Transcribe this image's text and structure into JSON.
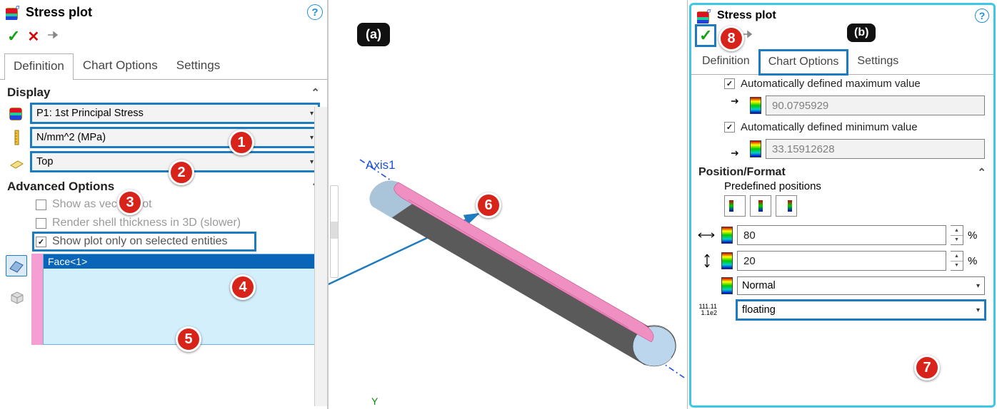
{
  "left": {
    "title": "Stress plot",
    "tabs": {
      "def": "Definition",
      "chart": "Chart Options",
      "set": "Settings"
    },
    "display": {
      "heading": "Display",
      "component": "P1: 1st Principal Stress",
      "units": "N/mm^2 (MPa)",
      "shell": "Top"
    },
    "adv": {
      "heading": "Advanced Options",
      "vector": "Show as vector plot",
      "render3d": "Render shell thickness in 3D (slower)",
      "only_sel": "Show plot only on selected entities",
      "sel_item": "Face<1>"
    }
  },
  "middle": {
    "pill": "(a)",
    "axis": "Axis1"
  },
  "right": {
    "title": "Stress plot",
    "pill": "(b)",
    "tabs": {
      "def": "Definition",
      "chart": "Chart Options",
      "set": "Settings"
    },
    "auto_max_label": "Automatically defined maximum value",
    "auto_max_val": "90.0795929",
    "auto_min_label": "Automatically defined minimum value",
    "auto_min_val": "33.15912628",
    "posfmt": {
      "heading": "Position/Format",
      "predef": "Predefined positions",
      "width": "80",
      "height": "20",
      "pct": "%",
      "normal": "Normal",
      "floating": "floating",
      "tick_lbl": "111.11\n1.1e2"
    }
  },
  "callouts": [
    "1",
    "2",
    "3",
    "4",
    "5",
    "6",
    "7",
    "8"
  ]
}
